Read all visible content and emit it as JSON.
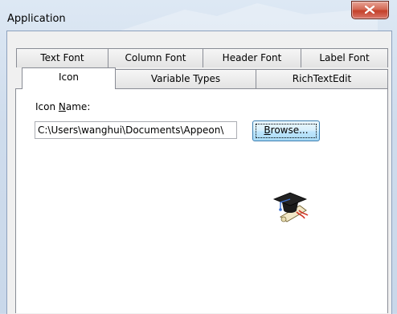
{
  "window": {
    "title": "Application",
    "close_glyph": "x"
  },
  "tabs_row_back": [
    {
      "label": "Text Font"
    },
    {
      "label": "Column Font"
    },
    {
      "label": "Header Font"
    },
    {
      "label": "Label Font"
    }
  ],
  "tabs_row_front": [
    {
      "label": "Icon",
      "active": true
    },
    {
      "label": "Variable Types"
    },
    {
      "label": "RichTextEdit"
    }
  ],
  "icon_panel": {
    "name_label_prefix": "Icon ",
    "name_label_mnemonic": "N",
    "name_label_suffix": "ame:",
    "path_value": "C:\\Users\\wanghui\\Documents\\Appeon\\",
    "browse_mnemonic": "B",
    "browse_rest": "rowse...",
    "preview_icon": "graduation-cap-diploma-icon"
  },
  "colors": {
    "window_frame": "#cfdcec",
    "close_button": "#c4402a",
    "panel_bg": "#ffffff",
    "dialog_bg": "#f0f0f0"
  }
}
